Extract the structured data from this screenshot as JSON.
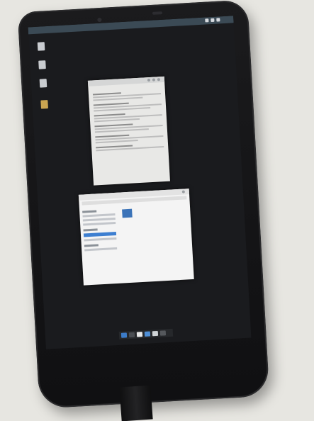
{
  "photo": {
    "subject": "",
    "desktop": {
      "top_bar_label": "",
      "desktop_icons": [
        {
          "name": "desktop-icon-1",
          "label": ""
        },
        {
          "name": "desktop-icon-2",
          "label": ""
        },
        {
          "name": "desktop-icon-3",
          "label": ""
        },
        {
          "name": "desktop-icon-4",
          "label": ""
        }
      ],
      "help_window": {
        "title": "",
        "heading": "",
        "subheading": ""
      },
      "file_manager": {
        "title": "",
        "sidebar_sections": [
          "",
          "",
          ""
        ]
      }
    }
  },
  "colors": {
    "wall": "#e7e6e1",
    "phone_body": "#161618",
    "screen_bg": "#1a1b1e",
    "window_bg": "#e8e8e6",
    "selection": "#3d7fd1"
  }
}
